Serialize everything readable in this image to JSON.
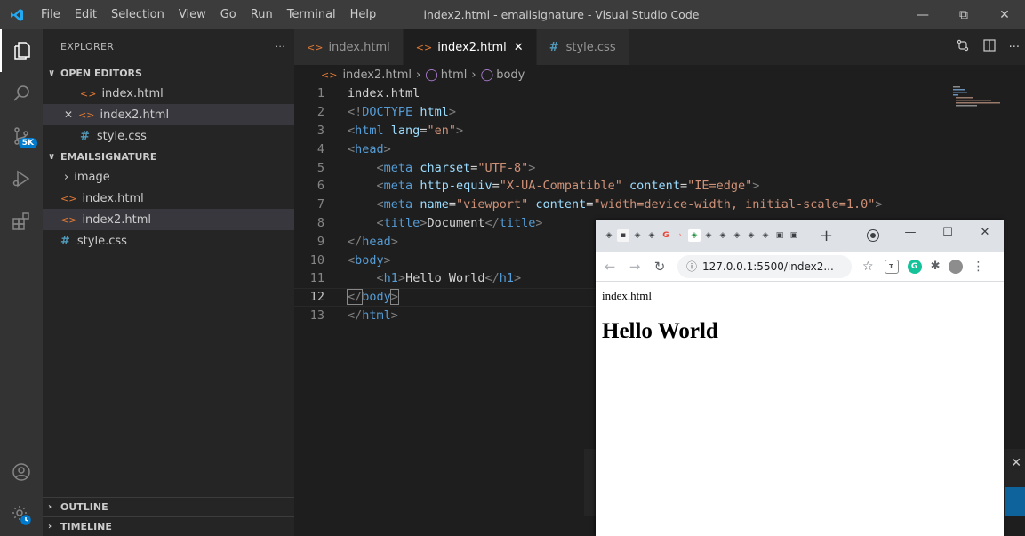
{
  "window": {
    "title": "index2.html - emailsignature - Visual Studio Code",
    "menu": [
      "File",
      "Edit",
      "Selection",
      "View",
      "Go",
      "Run",
      "Terminal",
      "Help"
    ]
  },
  "activity": {
    "badge": "5K"
  },
  "sidebar": {
    "header": "EXPLORER",
    "more": "···",
    "open_editors": {
      "title": "OPEN EDITORS",
      "items": [
        "index.html",
        "index2.html",
        "style.css"
      ]
    },
    "folder": {
      "title": "EMAILSIGNATURE",
      "items": [
        "image",
        "index.html",
        "index2.html",
        "style.css"
      ]
    },
    "outline": "OUTLINE",
    "timeline": "TIMELINE"
  },
  "tabs": [
    {
      "label": "index.html",
      "icon": "html-icon"
    },
    {
      "label": "index2.html",
      "icon": "html-icon"
    },
    {
      "label": "style.css",
      "icon": "css-icon"
    }
  ],
  "breadcrumb": [
    "index2.html",
    "html",
    "body"
  ],
  "code": {
    "line_numbers": [
      "1",
      "2",
      "3",
      "4",
      "5",
      "6",
      "7",
      "8",
      "9",
      "10",
      "11",
      "12",
      "13"
    ],
    "current_line": 12,
    "l1": "index.html",
    "doctype_open": "<!",
    "doctype_kw": "DOCTYPE",
    "doctype_html": "html",
    "doctype_close": ">",
    "tag_html": "html",
    "attr_lang": "lang",
    "val_en": "\"en\"",
    "tag_head": "head",
    "tag_meta": "meta",
    "attr_charset": "charset",
    "val_charset": "\"UTF-8\"",
    "attr_http": "http-equiv",
    "val_http": "\"X-UA-Compatible\"",
    "attr_content": "content",
    "val_ie": "\"IE=edge\"",
    "attr_name": "name",
    "val_viewport": "\"viewport\"",
    "val_width": "\"width=device-width, initial-scale=1.0\"",
    "tag_title": "title",
    "title_text": "Document",
    "tag_body": "body",
    "tag_h1": "h1",
    "h1_text": "Hello World",
    "lt": "<",
    "gt": ">",
    "lt_slash": "</",
    "eq": "="
  },
  "browser": {
    "url": "127.0.0.1:5500/index2...",
    "newtab": "+",
    "page_text": "index.html",
    "page_heading": "Hello World"
  }
}
